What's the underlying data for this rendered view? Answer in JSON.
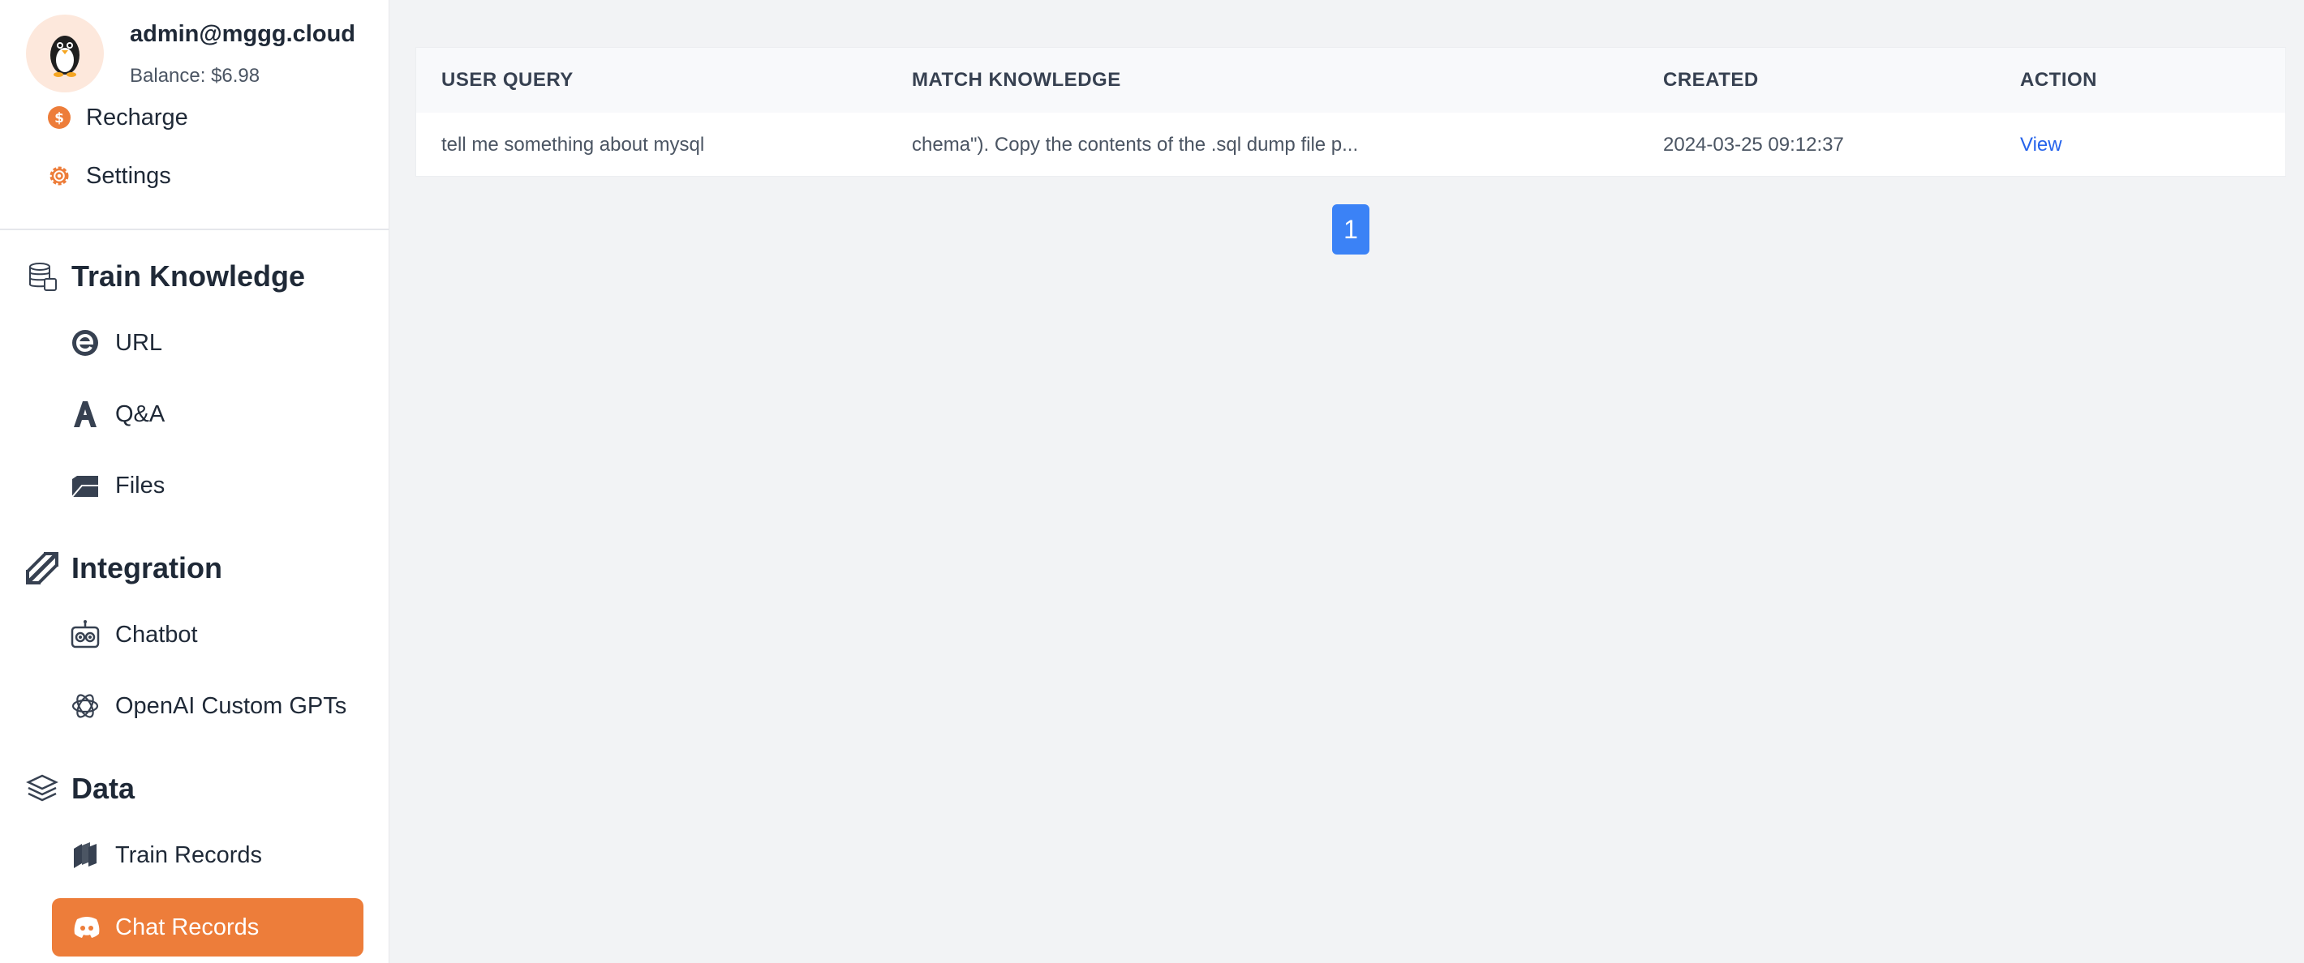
{
  "user": {
    "email": "admin@mggg.cloud",
    "balance": "Balance: $6.98"
  },
  "menu": {
    "recharge": "Recharge",
    "settings": "Settings"
  },
  "sections": {
    "train": {
      "title": "Train Knowledge",
      "items": [
        "URL",
        "Q&A",
        "Files"
      ]
    },
    "integration": {
      "title": "Integration",
      "items": [
        "Chatbot",
        "OpenAI Custom GPTs"
      ]
    },
    "data": {
      "title": "Data",
      "items": [
        "Train Records",
        "Chat Records"
      ]
    }
  },
  "table": {
    "headers": [
      "USER QUERY",
      "MATCH KNOWLEDGE",
      "CREATED",
      "ACTION"
    ],
    "rows": [
      {
        "user_query": "tell me something about mysql",
        "match_knowledge": "chema\"). Copy the contents of the .sql dump file p...",
        "created": "2024-03-25 09:12:37",
        "action": "View"
      }
    ]
  },
  "pagination": {
    "current_page": "1"
  },
  "colors": {
    "accent": "#ed7d3a",
    "link": "#2563eb",
    "page_button": "#3b82f6"
  }
}
